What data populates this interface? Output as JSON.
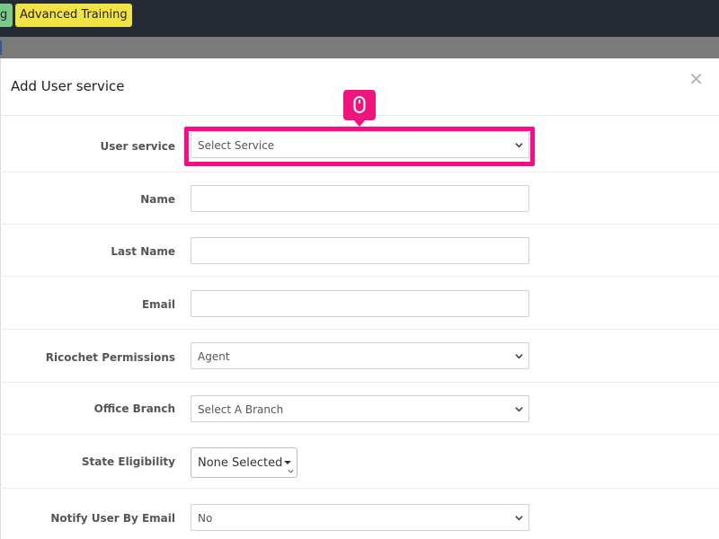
{
  "topbar": {
    "tags": [
      {
        "label": "g",
        "color": "#7bc98a"
      },
      {
        "label": "Advanced Training",
        "color": "#f2e345"
      }
    ]
  },
  "modal": {
    "title": "Add User service",
    "close_icon": "close-icon"
  },
  "form": {
    "user_service": {
      "label": "User service",
      "value": "Select Service"
    },
    "name": {
      "label": "Name",
      "value": ""
    },
    "last_name": {
      "label": "Last Name",
      "value": ""
    },
    "email": {
      "label": "Email",
      "value": ""
    },
    "ricochet_permissions": {
      "label": "Ricochet Permissions",
      "value": "Agent"
    },
    "office_branch": {
      "label": "Office Branch",
      "value": "Select A Branch"
    },
    "state_eligibility": {
      "label": "State Eligibility",
      "value": "None Selected"
    },
    "notify_user_by_email": {
      "label": "Notify User By Email",
      "value": "No"
    }
  },
  "tooltip": {
    "icon": "mouse-icon",
    "color": "#f0147e"
  },
  "highlight": {
    "color": "#ff0a85"
  }
}
